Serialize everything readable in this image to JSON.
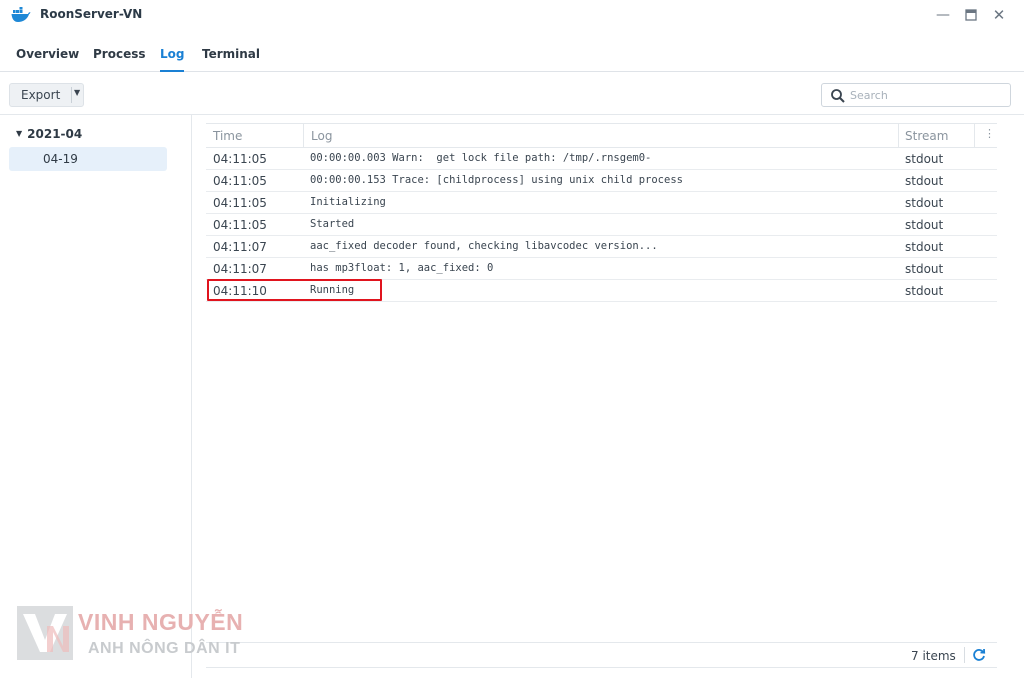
{
  "window": {
    "title": "RoonServer-VN",
    "icon": "docker-whale-icon"
  },
  "tabs": [
    {
      "label": "Overview",
      "active": false
    },
    {
      "label": "Process",
      "active": false
    },
    {
      "label": "Log",
      "active": true
    },
    {
      "label": "Terminal",
      "active": false
    }
  ],
  "toolbar": {
    "export_label": "Export",
    "search_placeholder": "Search"
  },
  "tree": {
    "group_label": "2021-04",
    "selected_item": "04-19"
  },
  "grid": {
    "columns": {
      "time": "Time",
      "log": "Log",
      "stream": "Stream"
    },
    "rows": [
      {
        "time": "04:11:05",
        "log": "00:00:00.003 Warn:  get lock file path: /tmp/.rnsgem0-",
        "stream": "stdout"
      },
      {
        "time": "04:11:05",
        "log": "00:00:00.153 Trace: [childprocess] using unix child process",
        "stream": "stdout"
      },
      {
        "time": "04:11:05",
        "log": "Initializing",
        "stream": "stdout"
      },
      {
        "time": "04:11:05",
        "log": "Started",
        "stream": "stdout"
      },
      {
        "time": "04:11:07",
        "log": "aac_fixed decoder found, checking libavcodec version...",
        "stream": "stdout"
      },
      {
        "time": "04:11:07",
        "log": "has mp3float: 1, aac_fixed: 0",
        "stream": "stdout"
      },
      {
        "time": "04:11:10",
        "log": "Running",
        "stream": "stdout"
      }
    ],
    "highlight_color": "#e0141e"
  },
  "footer": {
    "item_count": "7 items"
  },
  "watermark": {
    "name": "VINH NGUYỄN",
    "subtitle": "ANH NÔNG DÂN IT"
  },
  "colors": {
    "accent": "#1a80d4",
    "selected_bg": "#e6f0fa"
  }
}
